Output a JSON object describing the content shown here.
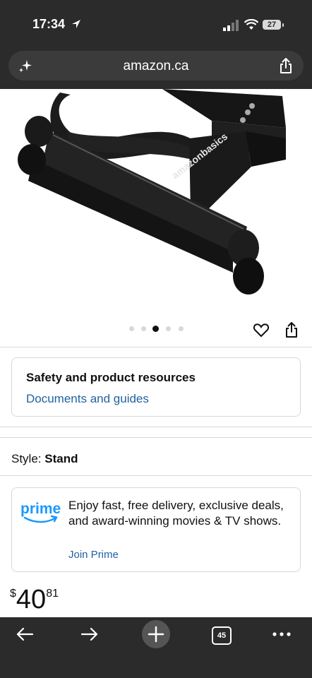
{
  "status_bar": {
    "time": "17:34",
    "battery": "27"
  },
  "browser": {
    "url": "amazon.ca",
    "tab_count": "45"
  },
  "product": {
    "image_brand": "amazonbasics",
    "image_count": 5,
    "active_image_index": 2
  },
  "safety": {
    "title": "Safety and product resources",
    "link": "Documents and guides"
  },
  "style": {
    "label": "Style:",
    "value": "Stand"
  },
  "prime": {
    "logo_text": "prime",
    "description": "Enjoy fast, free delivery, exclusive deals, and award-winning movies & TV shows.",
    "join_label": "Join Prime"
  },
  "price": {
    "currency": "$",
    "whole": "40",
    "fraction": "81"
  },
  "colors": {
    "link": "#2162a1",
    "prime_blue": "#1a98ff",
    "chrome_dark": "#2b2b2b"
  }
}
